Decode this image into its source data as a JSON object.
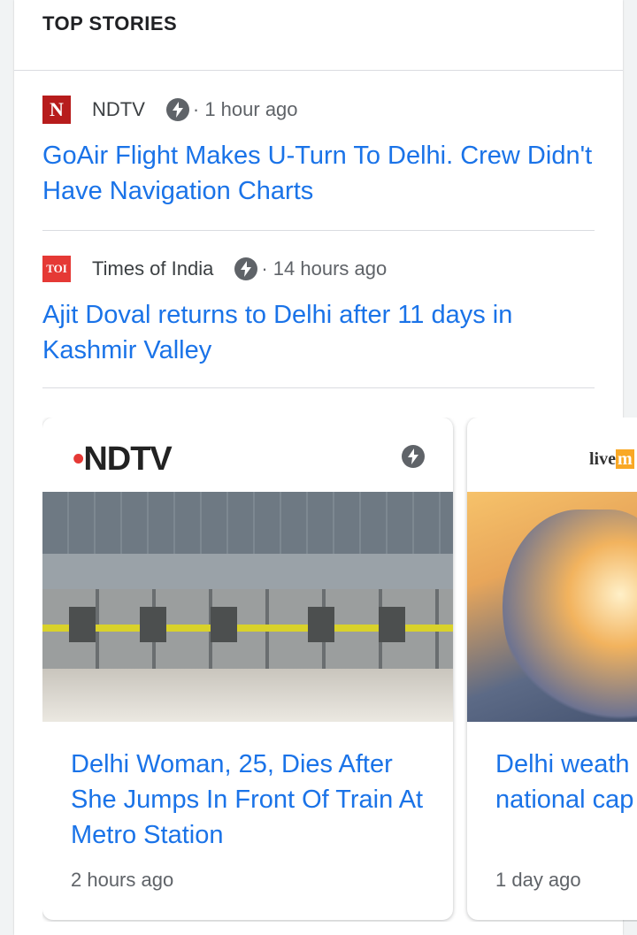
{
  "section_title": "TOP STORIES",
  "stories": [
    {
      "source": "NDTV",
      "logo_text": "N",
      "time": "· 1 hour ago",
      "headline": "GoAir Flight Makes U-Turn To Delhi. Crew Didn't Have Navigation Charts"
    },
    {
      "source": "Times of India",
      "logo_text": "TOI",
      "time": "· 14 hours ago",
      "headline": "Ajit Doval returns to Delhi after 11 days in Kashmir Valley"
    }
  ],
  "cards": [
    {
      "logo_text": "NDTV",
      "image": "metro-train-platform",
      "title": "Delhi Woman, 25, Dies After She Jumps In Front Of Train At Metro Station",
      "time": "2 hours ago"
    },
    {
      "logo_text": "live",
      "logo_accent": "m",
      "image": "cloudy-sky",
      "title": "Delhi weath Heavy rains national cap",
      "time": "1 day ago"
    }
  ],
  "icons": {
    "amp": "amp-lightning-icon"
  },
  "colors": {
    "link": "#1a73e8",
    "meta": "#5f6368",
    "ndtv_red": "#b71c1c",
    "toi_red": "#e53935"
  }
}
